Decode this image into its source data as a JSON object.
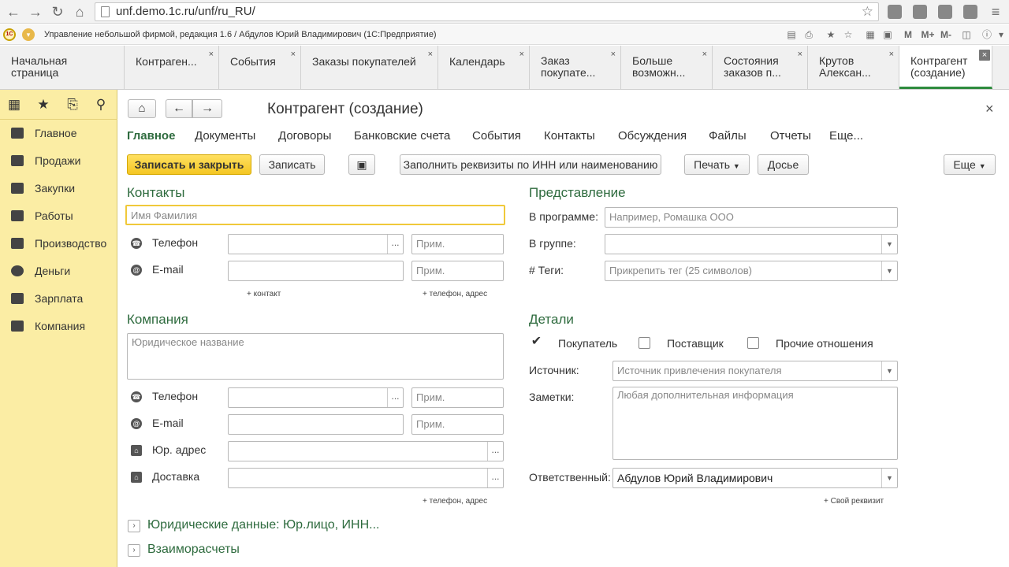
{
  "browser": {
    "url": "unf.demo.1c.ru/unf/ru_RU/"
  },
  "app": {
    "title": "Управление небольшой фирмой, редакция 1.6 / Абдулов Юрий Владимирович  (1С:Предприятие)",
    "toolbar_m": "M",
    "toolbar_mplus": "M+",
    "toolbar_mminus": "M-"
  },
  "tabs": [
    {
      "label": "Начальная\nстраница"
    },
    {
      "label": "Контраген..."
    },
    {
      "label": "События"
    },
    {
      "label": "Заказы покупателей"
    },
    {
      "label": "Календарь"
    },
    {
      "label": "Заказ\nпокупате..."
    },
    {
      "label": "Больше\nвозможн..."
    },
    {
      "label": "Состояния\nзаказов п..."
    },
    {
      "label": "Крутов\nАлексан..."
    },
    {
      "label": "Контрагент\n(создание)"
    }
  ],
  "sidebar": {
    "items": [
      {
        "label": "Главное"
      },
      {
        "label": "Продажи"
      },
      {
        "label": "Закупки"
      },
      {
        "label": "Работы"
      },
      {
        "label": "Производство"
      },
      {
        "label": "Деньги"
      },
      {
        "label": "Зарплата"
      },
      {
        "label": "Компания"
      }
    ]
  },
  "form": {
    "title": "Контрагент (создание)",
    "close": "×",
    "nav": [
      "Главное",
      "Документы",
      "Договоры",
      "Банковские счета",
      "События",
      "Контакты",
      "Обсуждения",
      "Файлы",
      "Отчеты",
      "Еще..."
    ],
    "buttons": {
      "save_close": "Записать и закрыть",
      "save": "Записать",
      "fill": "Заполнить реквизиты по ИНН или наименованию",
      "print": "Печать",
      "dossier": "Досье",
      "more": "Еще"
    },
    "contacts": {
      "heading": "Контакты",
      "name_placeholder": "Имя Фамилия",
      "phone_label": "Телефон",
      "email_label": "E-mail",
      "note_placeholder": "Прим.",
      "add_contact": "+ контакт",
      "add_phone": "+ телефон, адрес"
    },
    "company": {
      "heading": "Компания",
      "legal_name_placeholder": "Юридическое название",
      "phone_label": "Телефон",
      "email_label": "E-mail",
      "legal_address_label": "Юр. адрес",
      "delivery_label": "Доставка",
      "note_placeholder": "Прим.",
      "add_phone": "+ телефон, адрес"
    },
    "presentation": {
      "heading": "Представление",
      "in_program_label": "В программе:",
      "in_program_placeholder": "Например, Ромашка ООО",
      "group_label": "В группе:",
      "tags_label": "# Теги:",
      "tags_placeholder": "Прикрепить тег (25 символов)"
    },
    "details": {
      "heading": "Детали",
      "buyer": "Покупатель",
      "supplier": "Поставщик",
      "other": "Прочие отношения",
      "source_label": "Источник:",
      "source_placeholder": "Источник привлечения покупателя",
      "notes_label": "Заметки:",
      "notes_placeholder": "Любая дополнительная информация",
      "responsible_label": "Ответственный:",
      "responsible_value": "Абдулов Юрий Владимирович",
      "custom_attr": "+ Свой реквизит"
    },
    "legal_data": "Юридические данные: Юр.лицо, ИНН...",
    "settlements": "Взаиморасчеты"
  }
}
